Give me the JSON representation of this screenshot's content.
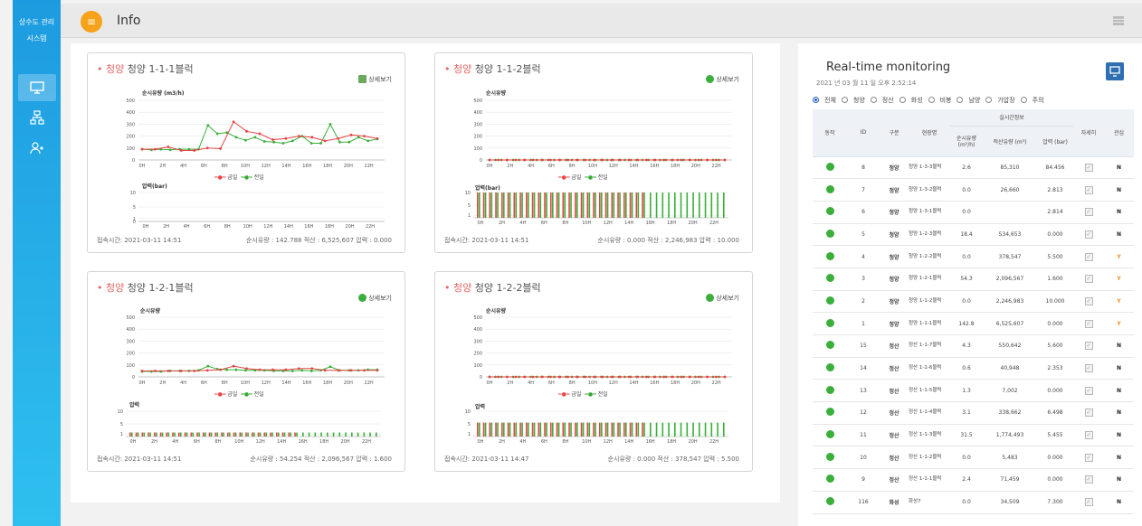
{
  "sidebar": {
    "title_line1": "상수도 관리",
    "title_line2": "시스템",
    "icons": [
      "monitor-icon",
      "sitemap-icon",
      "user-add-icon"
    ]
  },
  "header": {
    "title": "Info",
    "menu_icon": "menu-icon",
    "grid_icon": "grid-icon"
  },
  "cards": [
    {
      "title_prefix": "청양",
      "title": "청양 1-1-1블럭",
      "detail": "상세보기",
      "flow_label": "순시유량 (m3/h)",
      "pressure_label": "압력(bar)",
      "access": "접속시간: 2021-03-11 14:51",
      "summary": "순시유량 : 142.788 적산 : 6,525,607 압력 : 0.000"
    },
    {
      "title_prefix": "청양",
      "title": "청양 1-1-2블럭",
      "detail": "상세보기",
      "flow_label": "순시유량",
      "pressure_label": "압력(bar)",
      "access": "접속시간: 2021-03-11 14:51",
      "summary": "순시유량 : 0.000 적산 : 2,246,983 압력 : 10.000"
    },
    {
      "title_prefix": "청양",
      "title": "청양 1-2-1블럭",
      "detail": "상세보기",
      "flow_label": "순시유량",
      "pressure_label": "압력",
      "access": "접속시간: 2021-03-11 14:51",
      "summary": "순시유량 : 54.254 적산 : 2,096,567 압력 : 1.600"
    },
    {
      "title_prefix": "청양",
      "title": "청양 1-2-2블럭",
      "detail": "상세보기",
      "flow_label": "순시유량",
      "pressure_label": "압력",
      "access": "접속시간: 2021-03-11 14:47",
      "summary": "순시유량 : 0.000 적산 : 378,547 압력 : 5.500"
    }
  ],
  "legend": {
    "yesterday": "금일",
    "today": "전일"
  },
  "chart_data": [
    {
      "type": "line",
      "x": [
        "0H",
        "2H",
        "4H",
        "6H",
        "8H",
        "10H",
        "12H",
        "14H",
        "16H",
        "18H",
        "20H",
        "22H"
      ],
      "ylim": [
        0,
        500
      ],
      "yticks": [
        0,
        100,
        200,
        300,
        400,
        500
      ],
      "series": [
        {
          "name": "금일",
          "values": [
            90,
            90,
            110,
            80,
            80,
            100,
            95,
            320,
            240,
            220,
            170,
            180,
            200,
            190,
            160,
            180,
            210,
            200,
            180
          ]
        },
        {
          "name": "전일",
          "values": [
            90,
            85,
            90,
            85,
            90,
            90,
            90,
            290,
            220,
            230,
            190,
            165,
            190,
            155,
            150,
            140,
            160,
            200,
            140,
            140,
            300,
            150,
            150,
            190,
            160,
            175
          ]
        }
      ],
      "pressure": {
        "ylim": [
          0,
          10
        ],
        "yticks": [
          0,
          1,
          5,
          10
        ],
        "today": [],
        "yesterday": []
      }
    },
    {
      "type": "line",
      "x": [
        "0H",
        "2H",
        "4H",
        "6H",
        "8H",
        "10H",
        "12H",
        "14H",
        "16H",
        "18H",
        "20H",
        "22H"
      ],
      "ylim": [
        0,
        500
      ],
      "yticks": [
        0,
        100,
        200,
        300,
        400,
        500
      ],
      "series": [
        {
          "name": "금일",
          "values": [
            0,
            0,
            0,
            0,
            0,
            0,
            0,
            0,
            0,
            0,
            0,
            0,
            0,
            0,
            0,
            0,
            0,
            0,
            0,
            0,
            0,
            0,
            0,
            0,
            0,
            0,
            0,
            0
          ]
        },
        {
          "name": "전일",
          "values": [
            0,
            0,
            0,
            0,
            0,
            0,
            0,
            0,
            0,
            0,
            0,
            0,
            0,
            0,
            0,
            0,
            0,
            0,
            0,
            0,
            0,
            0,
            0,
            0,
            0,
            0,
            0,
            0,
            0,
            0,
            0,
            0,
            0,
            0,
            0,
            0,
            0,
            0,
            0,
            0,
            0
          ]
        }
      ],
      "pressure": {
        "ylim": [
          0,
          10
        ],
        "yticks": [
          1,
          5,
          10
        ],
        "today_count": 28,
        "yesterday_count": 41,
        "value": 10
      }
    },
    {
      "type": "line",
      "x": [
        "0H",
        "2H",
        "4H",
        "6H",
        "8H",
        "10H",
        "12H",
        "14H",
        "16H",
        "18H",
        "20H",
        "22H"
      ],
      "ylim": [
        0,
        500
      ],
      "yticks": [
        0,
        100,
        200,
        300,
        400,
        500
      ],
      "series": [
        {
          "name": "금일",
          "values": [
            50,
            50,
            50,
            50,
            50,
            55,
            60,
            90,
            70,
            60,
            60,
            60,
            70,
            70,
            55,
            55,
            55,
            55,
            55
          ]
        },
        {
          "name": "전일",
          "values": [
            45,
            45,
            45,
            50,
            50,
            50,
            55,
            90,
            65,
            60,
            60,
            55,
            55,
            55,
            50,
            50,
            50,
            55,
            50,
            55,
            85,
            55,
            55,
            55,
            60,
            60
          ]
        }
      ],
      "pressure": {
        "ylim": [
          0,
          10
        ],
        "yticks": [
          1,
          5,
          10
        ],
        "today_count": 28,
        "yesterday_count": 41,
        "value": 1.6
      }
    },
    {
      "type": "line",
      "x": [
        "0H",
        "2H",
        "4H",
        "6H",
        "8H",
        "10H",
        "12H",
        "14H",
        "16H",
        "18H",
        "20H",
        "22H"
      ],
      "ylim": [
        0,
        500
      ],
      "yticks": [
        0,
        100,
        200,
        300,
        400,
        500
      ],
      "series": [
        {
          "name": "금일",
          "values": [
            0,
            0,
            0,
            0,
            0,
            0,
            0,
            0,
            0,
            0,
            0,
            0,
            0,
            0,
            0,
            0,
            0,
            0,
            0,
            0,
            0,
            0,
            0,
            0,
            0,
            0,
            0,
            0
          ]
        },
        {
          "name": "전일",
          "values": [
            0,
            0,
            0,
            0,
            0,
            0,
            0,
            0,
            0,
            0,
            0,
            0,
            0,
            0,
            0,
            0,
            0,
            0,
            0,
            0,
            0,
            0,
            0,
            0,
            0,
            0,
            0,
            0,
            0,
            0,
            0,
            0,
            0,
            0,
            0,
            0,
            0,
            0,
            0,
            0,
            0
          ]
        }
      ],
      "pressure": {
        "ylim": [
          0,
          10
        ],
        "yticks": [
          1,
          5,
          10
        ],
        "today_count": 28,
        "yesterday_count": 41,
        "value": 5.5
      }
    }
  ],
  "monitor": {
    "title": "Real-time monitoring",
    "time": "2021 년 03 월 11 일 오후 2:52:14",
    "filters": [
      "전체",
      "청양",
      "정산",
      "화성",
      "비봉",
      "남양",
      "가압장",
      "주의"
    ],
    "headers": {
      "status": "동작",
      "id": "ID",
      "type": "구분",
      "site": "현장명",
      "realtime": "실시간정보",
      "flow": "순시유량 (m³/h)",
      "total": "적산유량 (m³)",
      "pressure": "압력 (bar)",
      "detail": "자세히",
      "fav": "관심"
    },
    "rows": [
      {
        "id": "8",
        "type": "청양",
        "site": "청양 1-3-3블럭",
        "flow": "2.6",
        "total": "85,310",
        "pressure": "84.456",
        "fav": "N"
      },
      {
        "id": "7",
        "type": "청양",
        "site": "청양 1-3-2블럭",
        "flow": "0.0",
        "total": "26,660",
        "pressure": "2.813",
        "fav": "N"
      },
      {
        "id": "6",
        "type": "청양",
        "site": "청양 1-3-1블럭",
        "flow": "0.0",
        "total": "",
        "pressure": "2.814",
        "fav": "N"
      },
      {
        "id": "5",
        "type": "청양",
        "site": "청양 1-2-3블럭",
        "flow": "18.4",
        "total": "534,653",
        "pressure": "0.000",
        "fav": "N"
      },
      {
        "id": "4",
        "type": "청양",
        "site": "청양 1-2-2블럭",
        "flow": "0.0",
        "total": "378,547",
        "pressure": "5.500",
        "fav": "Y"
      },
      {
        "id": "3",
        "type": "청양",
        "site": "청양 1-2-1블럭",
        "flow": "54.3",
        "total": "2,096,567",
        "pressure": "1.600",
        "fav": "Y"
      },
      {
        "id": "2",
        "type": "청양",
        "site": "청양 1-1-2블럭",
        "flow": "0.0",
        "total": "2,246,983",
        "pressure": "10.000",
        "fav": "Y"
      },
      {
        "id": "1",
        "type": "청양",
        "site": "청양 1-1-1블럭",
        "flow": "142.8",
        "total": "6,525,607",
        "pressure": "0.000",
        "fav": "Y"
      },
      {
        "id": "15",
        "type": "정산",
        "site": "정산 1-1-7블럭",
        "flow": "4.3",
        "total": "550,642",
        "pressure": "5.600",
        "fav": "N"
      },
      {
        "id": "14",
        "type": "정산",
        "site": "정산 1-1-6블럭",
        "flow": "0.6",
        "total": "40,948",
        "pressure": "2.353",
        "fav": "N"
      },
      {
        "id": "13",
        "type": "정산",
        "site": "정산 1-1-5블럭",
        "flow": "1.3",
        "total": "7,002",
        "pressure": "0.000",
        "fav": "N"
      },
      {
        "id": "12",
        "type": "정산",
        "site": "정산 1-1-4블럭",
        "flow": "3.1",
        "total": "338,662",
        "pressure": "6.498",
        "fav": "N"
      },
      {
        "id": "11",
        "type": "정산",
        "site": "정산 1-1-3블럭",
        "flow": "31.5",
        "total": "1,774,493",
        "pressure": "5.455",
        "fav": "N"
      },
      {
        "id": "10",
        "type": "정산",
        "site": "정산 1-1-2블럭",
        "flow": "0.0",
        "total": "5,483",
        "pressure": "0.000",
        "fav": "N"
      },
      {
        "id": "9",
        "type": "정산",
        "site": "정산 1-1-1블럭",
        "flow": "2.4",
        "total": "71,459",
        "pressure": "0.000",
        "fav": "N"
      },
      {
        "id": "116",
        "type": "화성",
        "site": "화성7",
        "flow": "0.0",
        "total": "34,509",
        "pressure": "7.300",
        "fav": "N"
      }
    ]
  },
  "colors": {
    "accent": "#f7a21b",
    "sidebar": "#1d9be0",
    "today": "#e44444",
    "yesterday": "#3aaf3a",
    "fav_yes": "#f28b1f"
  }
}
